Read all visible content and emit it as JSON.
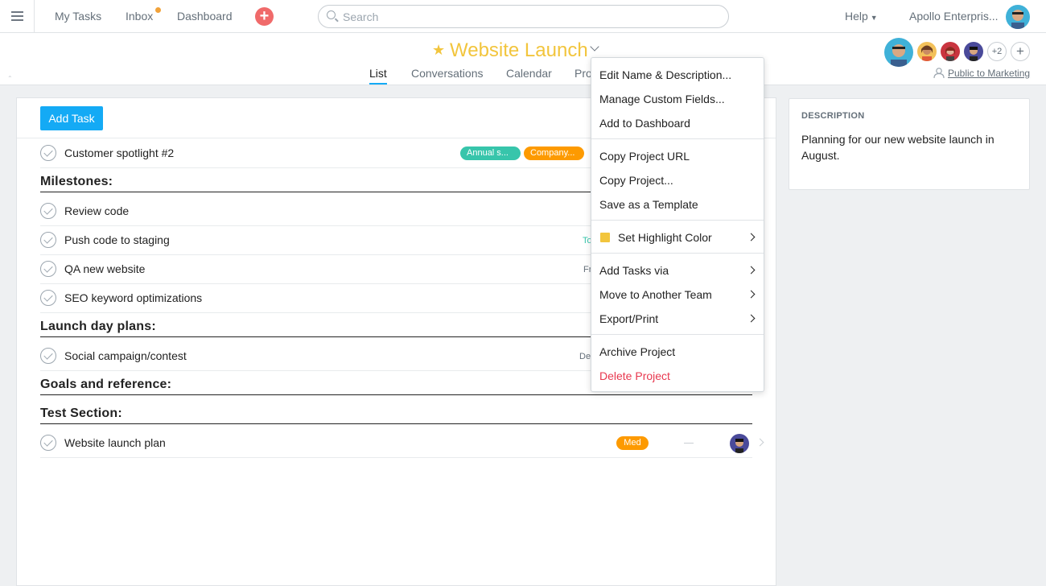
{
  "topbar": {
    "my_tasks": "My Tasks",
    "inbox": "Inbox",
    "dashboard": "Dashboard",
    "add_icon": "plus-icon",
    "search_placeholder": "Search",
    "help": "Help",
    "organization": "Apollo Enterpris..."
  },
  "project": {
    "title": "Website Launch",
    "starred": true,
    "tabs": [
      "List",
      "Conversations",
      "Calendar",
      "Pro"
    ],
    "active_tab": "List",
    "more_members": "+2",
    "visibility": "Public to Marketing"
  },
  "list": {
    "add_task_label": "Add Task",
    "rows": [
      {
        "type": "task",
        "name": "Customer spotlight #2",
        "tags": [
          "Annual s...",
          "Company..."
        ]
      },
      {
        "type": "section",
        "name": "Milestones:"
      },
      {
        "type": "task",
        "name": "Review code"
      },
      {
        "type": "task",
        "name": "Push code to staging",
        "peek": "To"
      },
      {
        "type": "task",
        "name": "QA new website",
        "peek": "Fr"
      },
      {
        "type": "task",
        "name": "SEO keyword optimizations"
      },
      {
        "type": "section",
        "name": "Launch day plans:"
      },
      {
        "type": "task",
        "name": "Social campaign/contest",
        "peek": "De"
      },
      {
        "type": "section",
        "name": "Goals and reference:"
      },
      {
        "type": "section",
        "name": "Test Section:"
      },
      {
        "type": "task",
        "name": "Website launch plan",
        "tags": [
          "Med"
        ]
      }
    ]
  },
  "description": {
    "title": "DESCRIPTION",
    "text": "Planning for our new website launch in August."
  },
  "menu": {
    "items": [
      "Edit Name & Description...",
      "Manage Custom Fields...",
      "Add to Dashboard",
      "Copy Project URL",
      "Copy Project...",
      "Save as a Template",
      "Set Highlight Color",
      "Add Tasks via",
      "Move to Another Team",
      "Export/Print",
      "Archive Project",
      "Delete Project"
    ]
  },
  "colors": {
    "accent": "#14aaf5",
    "title": "#f2c53d",
    "tag_teal": "#37c5ab",
    "tag_orange": "#fd9a00",
    "danger": "#e8384f",
    "inbox_dot": "#f1a23a",
    "add_button": "#f06a6a"
  }
}
